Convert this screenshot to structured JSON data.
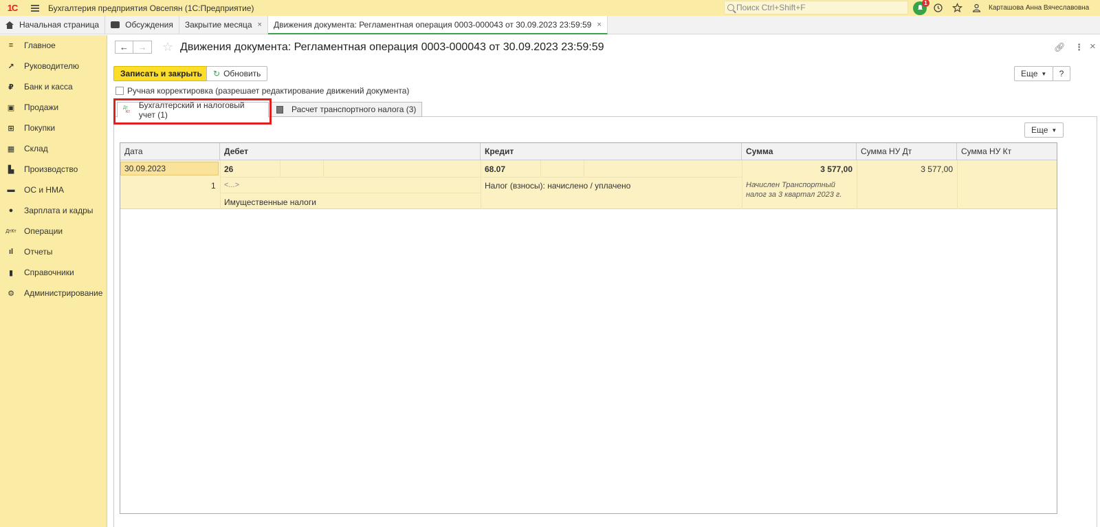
{
  "app": {
    "logo": "1С",
    "title": "Бухгалтерия предприятия Овсепян  (1С:Предприятие)",
    "search_placeholder": "Поиск Ctrl+Shift+F",
    "notification_count": "1",
    "user": "Карташова Анна Вячеславовна"
  },
  "window_tabs": [
    {
      "label": "Начальная страница"
    },
    {
      "label": "Обсуждения"
    },
    {
      "label": "Закрытие месяца",
      "close": "×"
    },
    {
      "label": "Движения документа: Регламентная операция 0003-000043 от 30.09.2023 23:59:59",
      "close": "×"
    }
  ],
  "sidebar": {
    "items": [
      {
        "label": "Главное",
        "icon": "menu-icon"
      },
      {
        "label": "Руководителю",
        "icon": "trend-icon"
      },
      {
        "label": "Банк и касса",
        "icon": "ruble-coin-icon"
      },
      {
        "label": "Продажи",
        "icon": "bag-icon"
      },
      {
        "label": "Покупки",
        "icon": "cart-icon"
      },
      {
        "label": "Склад",
        "icon": "warehouse-icon"
      },
      {
        "label": "Производство",
        "icon": "factory-icon"
      },
      {
        "label": "ОС и НМА",
        "icon": "truck-icon"
      },
      {
        "label": "Зарплата и кадры",
        "icon": "person-icon"
      },
      {
        "label": "Операции",
        "icon": "dt-kt-icon"
      },
      {
        "label": "Отчеты",
        "icon": "bar-chart-icon"
      },
      {
        "label": "Справочники",
        "icon": "books-icon"
      },
      {
        "label": "Администрирование",
        "icon": "gear-icon"
      }
    ]
  },
  "document": {
    "title": "Движения документа: Регламентная операция 0003-000043 от 30.09.2023 23:59:59",
    "save_close": "Записать и закрыть",
    "refresh": "Обновить",
    "more": "Еще",
    "help": "?",
    "manual_edit": "Ручная корректировка (разрешает редактирование движений документа)",
    "tabs": [
      {
        "label": "Бухгалтерский и налоговый учет (1)",
        "icon_top": "Дт",
        "icon_bottom": "Кт"
      },
      {
        "label": "Расчет транспортного налога (3)"
      }
    ],
    "grid_more": "Еще"
  },
  "grid": {
    "columns": [
      "Дата",
      "Дебет",
      "Кредит",
      "Сумма",
      "Сумма НУ Дт",
      "Сумма НУ Кт"
    ],
    "row": {
      "date": "30.09.2023",
      "line_no": "1",
      "debit_account": "26",
      "debit_sub1": "<...>",
      "debit_sub2": "Имущественные налоги",
      "credit_account": "68.07",
      "credit_sub1": "Налог (взносы): начислено / уплачено",
      "amount": "3 577,00",
      "content": "Начислен Транспортный налог за 3 квартал 2023 г.",
      "amount_nu_dt": "3 577,00",
      "amount_nu_kt": ""
    }
  },
  "colors": {
    "panel_yellow": "#fbeca5",
    "primary_button": "#fbdd2a",
    "accent_green": "#3aa34a",
    "highlight_red": "#e01f1f",
    "row_selected": "#fcf1c3"
  }
}
